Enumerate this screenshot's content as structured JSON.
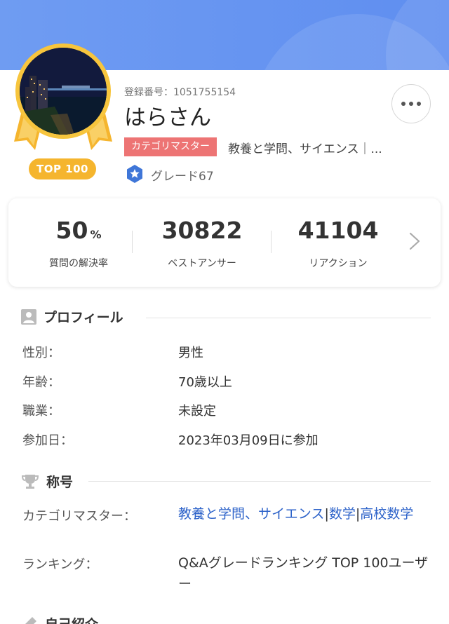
{
  "header": {
    "registration_no": "登録番号：1051755154",
    "user_name": "はらさん",
    "top_badge": "TOP 100",
    "category_badge": "カテゴリマスター",
    "category_text": "教養と学問、サイエンス｜...",
    "grade": "グレード67"
  },
  "stats": [
    {
      "value": "50",
      "unit": "%",
      "label": "質問の解決率"
    },
    {
      "value": "30822",
      "unit": "",
      "label": "ベストアンサー"
    },
    {
      "value": "41104",
      "unit": "",
      "label": "リアクション"
    }
  ],
  "profile": {
    "title": "プロフィール",
    "rows": [
      {
        "label": "性別：",
        "value": "男性"
      },
      {
        "label": "年齢：",
        "value": "70歳以上"
      },
      {
        "label": "職業：",
        "value": "未設定"
      },
      {
        "label": "参加日：",
        "value": "2023年03月09日に参加"
      }
    ]
  },
  "titles": {
    "title": "称号",
    "category_master_label": "カテゴリマスター：",
    "category_links": [
      "教養と学問、サイエンス",
      "数学",
      "高校数学"
    ],
    "separator": "|",
    "ranking_label": "ランキング：",
    "ranking_value": "Q&Aグレードランキング TOP 100ユーザー"
  },
  "next_section": {
    "title": "自己紹介"
  },
  "colors": {
    "header": "#6f9cf2",
    "medal": "#f7c53d",
    "badge": "#f5b52e",
    "category_badge": "#ed7474",
    "link": "#2c62c9",
    "grade_icon": "#3f76d8"
  }
}
